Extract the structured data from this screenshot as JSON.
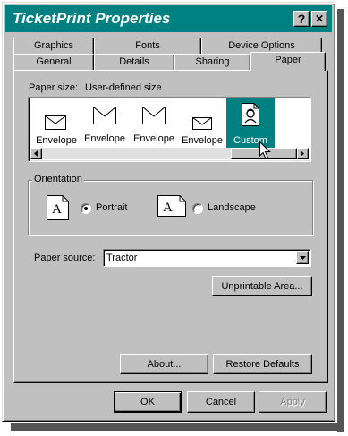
{
  "window": {
    "title": "TicketPrint Properties",
    "help_glyph": "?",
    "close_glyph": "✕"
  },
  "tabs": {
    "back_row": [
      "Graphics",
      "Fonts",
      "Device Options"
    ],
    "front_row": [
      "General",
      "Details",
      "Sharing",
      "Paper"
    ],
    "active": "Paper"
  },
  "paper": {
    "size_label": "Paper size:",
    "size_value": "User-defined size",
    "items": [
      {
        "label": "Envelope",
        "icon": "envelope-icon"
      },
      {
        "label": "Envelope",
        "icon": "envelope-icon"
      },
      {
        "label": "Envelope",
        "icon": "envelope-icon"
      },
      {
        "label": "Envelope",
        "icon": "envelope-icon"
      },
      {
        "label": "Custom",
        "icon": "custom-paper-icon",
        "selected": true
      }
    ]
  },
  "orientation": {
    "group_label": "Orientation",
    "portrait_label": "Portrait",
    "landscape_label": "Landscape",
    "selected": "Portrait",
    "preview_glyph": "A"
  },
  "source": {
    "label": "Paper source:",
    "value": "Tractor"
  },
  "buttons": {
    "unprintable": "Unprintable Area...",
    "about": "About...",
    "restore": "Restore Defaults",
    "ok": "OK",
    "cancel": "Cancel",
    "apply": "Apply"
  },
  "colors": {
    "titlebar": "#008080",
    "face": "#c0c0c0",
    "selection": "#008080"
  }
}
